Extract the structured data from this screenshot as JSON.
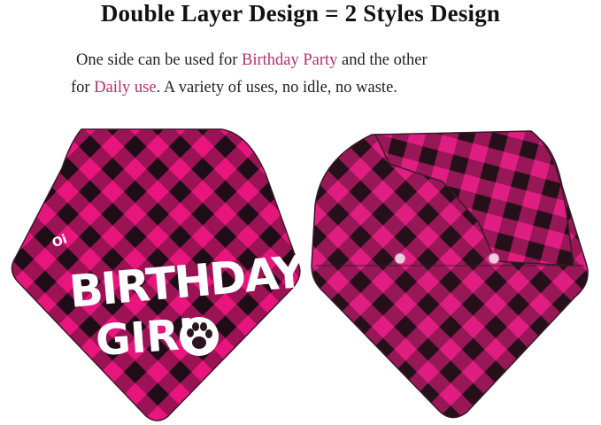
{
  "heading": "Double Layer Design = 2 Styles Design",
  "description": {
    "line1_before": "One side can be used for ",
    "line1_highlight": "Birthday Party",
    "line1_after": " and the other",
    "line2_before": "for ",
    "line2_highlight": "Daily use",
    "line2_after": ". A variety of uses, no idle, no waste."
  },
  "left_bandana": {
    "print_line1": "BIRTHDAY",
    "print_line2": "GIRL",
    "small_text": "Oi",
    "paw_icon": "paw-print-icon"
  },
  "colors": {
    "pink": "#e8157d",
    "black": "#2a1520",
    "highlight": "#b0306a"
  }
}
